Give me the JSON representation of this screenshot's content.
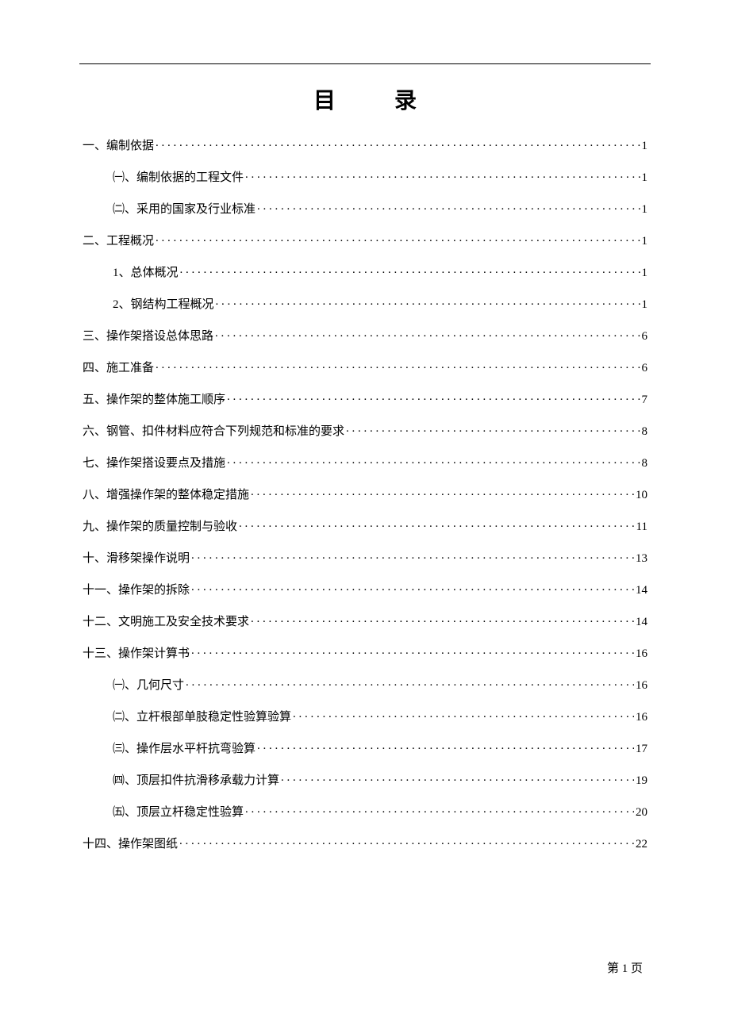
{
  "title_left": "目",
  "title_right": "录",
  "footer": "第 1 页",
  "toc": [
    {
      "label": "一、编制依据",
      "page": "1",
      "indent": 0
    },
    {
      "label": "㈠、编制依据的工程文件",
      "page": "1",
      "indent": 1
    },
    {
      "label": "㈡、采用的国家及行业标准",
      "page": "1",
      "indent": 1
    },
    {
      "label": "二、工程概况",
      "page": "1",
      "indent": 0
    },
    {
      "label": "1、总体概况",
      "page": "1",
      "indent": 1
    },
    {
      "label": "2、钢结构工程概况",
      "page": "1",
      "indent": 1
    },
    {
      "label": "三、操作架搭设总体思路",
      "page": "6",
      "indent": 0
    },
    {
      "label": "四、施工准备",
      "page": "6",
      "indent": 0
    },
    {
      "label": "五、操作架的整体施工顺序",
      "page": "7",
      "indent": 0
    },
    {
      "label": "六、钢管、扣件材料应符合下列规范和标准的要求",
      "page": "8",
      "indent": 0
    },
    {
      "label": "七、操作架搭设要点及措施",
      "page": "8",
      "indent": 0
    },
    {
      "label": "八、增强操作架的整体稳定措施",
      "page": "10",
      "indent": 0
    },
    {
      "label": "九、操作架的质量控制与验收",
      "page": "11",
      "indent": 0
    },
    {
      "label": "十、滑移架操作说明",
      "page": "13",
      "indent": 0
    },
    {
      "label": "十一、操作架的拆除",
      "page": "14",
      "indent": 0
    },
    {
      "label": "十二、文明施工及安全技术要求",
      "page": "14",
      "indent": 0
    },
    {
      "label": "十三、操作架计算书",
      "page": "16",
      "indent": 0
    },
    {
      "label": "㈠、几何尺寸",
      "page": "16",
      "indent": 1
    },
    {
      "label": "㈡、立杆根部单肢稳定性验算验算",
      "page": "16",
      "indent": 1
    },
    {
      "label": "㈢、操作层水平杆抗弯验算",
      "page": "17",
      "indent": 1
    },
    {
      "label": "㈣、顶层扣件抗滑移承载力计算",
      "page": "19",
      "indent": 1
    },
    {
      "label": "㈤、顶层立杆稳定性验算",
      "page": "20",
      "indent": 1
    },
    {
      "label": "十四、操作架图纸",
      "page": "22",
      "indent": 0
    }
  ]
}
